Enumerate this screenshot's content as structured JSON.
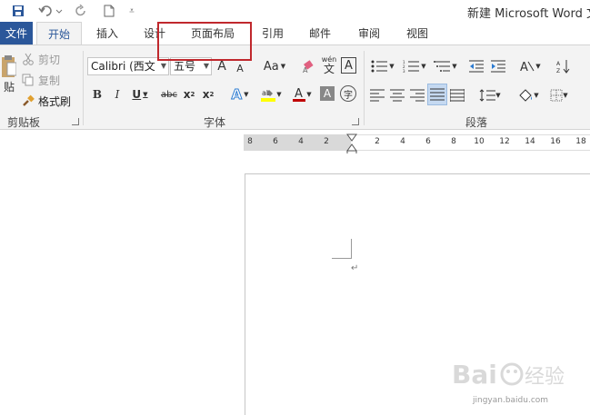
{
  "window": {
    "title": "新建 Microsoft Word 文"
  },
  "tabs": {
    "file": "文件",
    "home": "开始",
    "insert": "插入",
    "design": "设计",
    "layout": "页面布局",
    "references": "引用",
    "mailings": "邮件",
    "review": "审阅",
    "view": "视图"
  },
  "clipboard": {
    "paste": "贴",
    "cut": "剪切",
    "copy": "复制",
    "format_painter": "格式刷",
    "group_label": "剪贴板"
  },
  "font": {
    "font_name": "Calibri (西文",
    "font_size": "五号",
    "group_label": "字体",
    "aa_label": "Aa",
    "wen": "wén",
    "wen_char": "文"
  },
  "paragraph": {
    "group_label": "段落"
  },
  "ruler": {
    "left_ticks": [
      "8",
      "6",
      "4",
      "2"
    ],
    "right_ticks": [
      "2",
      "4",
      "6",
      "8",
      "10",
      "12",
      "14",
      "16",
      "18"
    ]
  },
  "watermark": {
    "brand": "Baidu 经验",
    "url": "jingyan.baidu.com"
  },
  "colors": {
    "accent": "#2b579a",
    "highlight_box": "#c0282d",
    "font_color": "#c00000",
    "highlight_yellow": "#ffff00"
  }
}
